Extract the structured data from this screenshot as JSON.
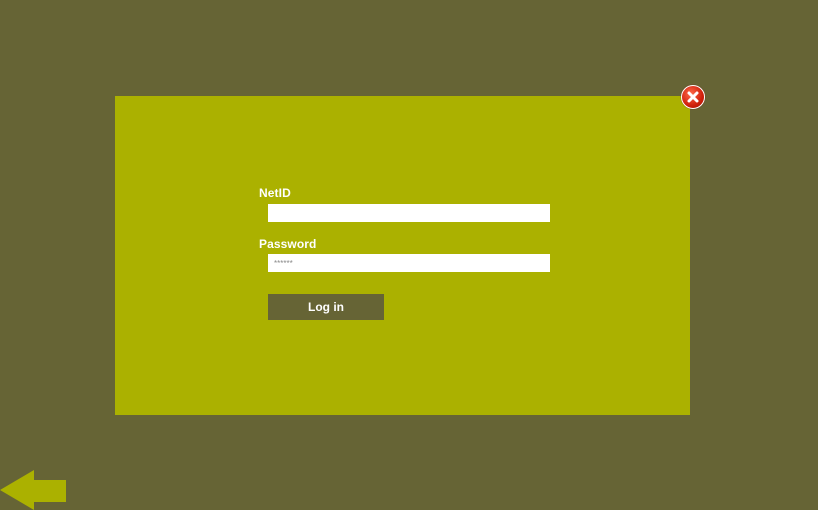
{
  "login_dialog": {
    "netid_label": "NetID",
    "netid_value": "",
    "password_label": "Password",
    "password_placeholder": "******",
    "login_button": "Log in"
  },
  "icons": {
    "close": "close-icon",
    "back": "back-arrow-icon"
  },
  "colors": {
    "background": "#666435",
    "dialog": "#abb100",
    "button": "#666435",
    "close": "#d0200c"
  }
}
